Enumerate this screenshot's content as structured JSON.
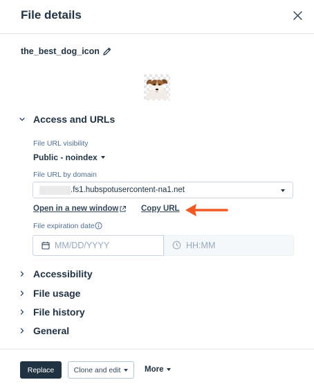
{
  "header": {
    "title": "File details"
  },
  "file": {
    "name": "the_best_dog_icon"
  },
  "sections": {
    "access": {
      "label": "Access and URLs",
      "visibility_label": "File URL visibility",
      "visibility_value": "Public - noindex",
      "domain_label": "File URL by domain",
      "domain_value": ".fs1.hubspotusercontent-na1.net",
      "open_link": "Open in a new window",
      "copy_link": "Copy URL",
      "expiration_label": "File expiration date",
      "date_placeholder": "MM/DD/YYYY",
      "time_placeholder": "HH:MM"
    },
    "accessibility": {
      "label": "Accessibility"
    },
    "usage": {
      "label": "File usage"
    },
    "history": {
      "label": "File history"
    },
    "general": {
      "label": "General"
    }
  },
  "footer": {
    "replace": "Replace",
    "clone": "Clone and edit",
    "more": "More"
  },
  "colors": {
    "primary": "#213343",
    "text": "#33475b",
    "muted": "#516f90",
    "border": "#cbd6e2",
    "arrow": "#f05a22"
  }
}
